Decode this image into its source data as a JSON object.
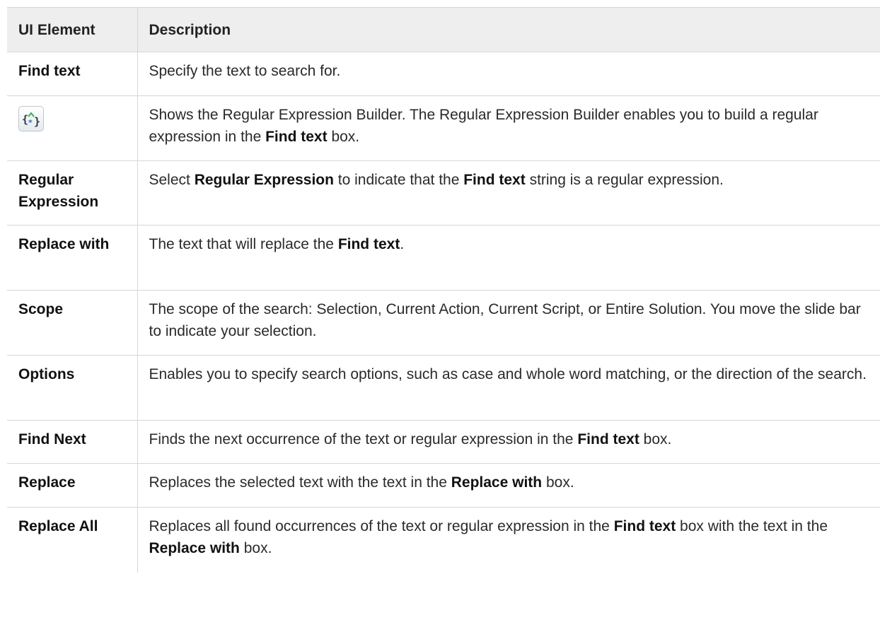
{
  "header": {
    "col1": "UI Element",
    "col2": "Description"
  },
  "rows": [
    {
      "name": "Find text",
      "desc": [
        "Specify the text to search for."
      ]
    },
    {
      "icon": "regex-builder-icon",
      "desc": [
        "Shows the Regular Expression Builder. The Regular Expression Builder enables you to build a regular expression in the ",
        "Find text",
        " box."
      ]
    },
    {
      "name": "Regular Expression",
      "desc": [
        "Select ",
        "Regular Expression",
        " to indicate that the ",
        "Find text",
        " string is a regular expression."
      ]
    },
    {
      "name": "Replace with",
      "desc": [
        "The text that will replace the ",
        "Find text",
        "."
      ]
    },
    {
      "name": "Scope",
      "desc": [
        "The scope of the search: Selection, Current Action, Current Script, or Entire Solution. You move the slide bar to indicate your selection."
      ]
    },
    {
      "name": "Options",
      "desc": [
        "Enables you to specify search options, such as case and whole word matching, or the direction of the search."
      ]
    },
    {
      "name": "Find Next",
      "desc": [
        "Finds the next occurrence of the text or regular expression in the ",
        "Find text",
        " box."
      ]
    },
    {
      "name": "Replace",
      "desc": [
        "Replaces the selected text with the text in the ",
        "Replace with",
        " box."
      ]
    },
    {
      "name": "Replace All",
      "desc": [
        "Replaces all found occurrences of the text or regular expression in the ",
        "Find text",
        " box with the text in the ",
        "Replace with",
        " box."
      ]
    }
  ]
}
